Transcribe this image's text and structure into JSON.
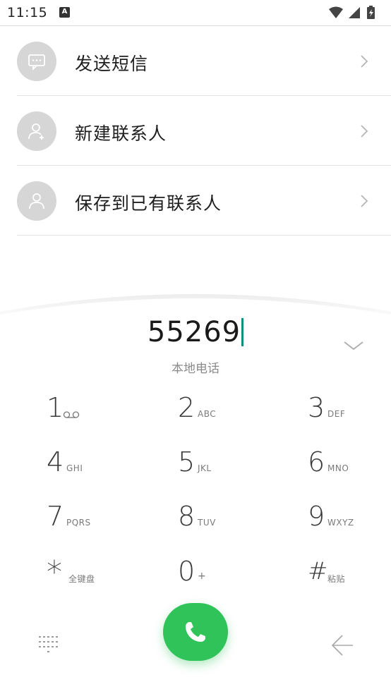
{
  "status": {
    "time": "11:15",
    "app_badge": "A"
  },
  "actions": [
    {
      "label": "发送短信",
      "icon": "message-icon"
    },
    {
      "label": "新建联系人",
      "icon": "add-contact-icon"
    },
    {
      "label": "保存到已有联系人",
      "icon": "contact-icon"
    }
  ],
  "dialer": {
    "number": "55269",
    "location": "本地电话",
    "keys": [
      {
        "digit": "1",
        "sub": ""
      },
      {
        "digit": "2",
        "sub": "ABC"
      },
      {
        "digit": "3",
        "sub": "DEF"
      },
      {
        "digit": "4",
        "sub": "GHI"
      },
      {
        "digit": "5",
        "sub": "JKL"
      },
      {
        "digit": "6",
        "sub": "MNO"
      },
      {
        "digit": "7",
        "sub": "PQRS"
      },
      {
        "digit": "8",
        "sub": "TUV"
      },
      {
        "digit": "9",
        "sub": "WXYZ"
      },
      {
        "digit": "*",
        "sub": "全键盘"
      },
      {
        "digit": "0",
        "sub": "+"
      },
      {
        "digit": "#",
        "sub": "粘贴"
      }
    ]
  },
  "colors": {
    "call": "#2fc35a",
    "cursor": "#0f8f7f",
    "avatar": "#d6d6d6"
  }
}
